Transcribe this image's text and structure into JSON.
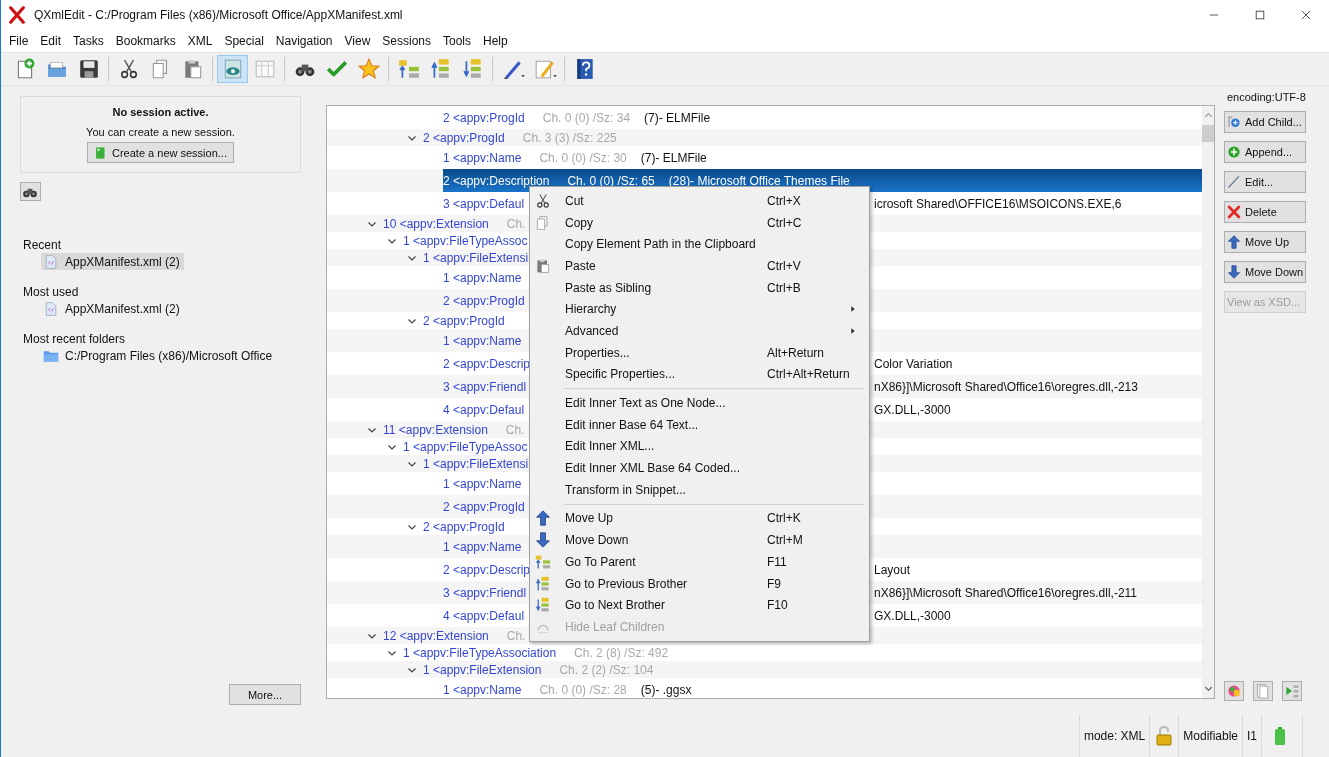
{
  "window": {
    "title": "QXmlEdit - C:/Program Files (x86)/Microsoft Office/AppXManifest.xml"
  },
  "menu_bar": [
    "File",
    "Edit",
    "Tasks",
    "Bookmarks",
    "XML",
    "Special",
    "Navigation",
    "View",
    "Sessions",
    "Tools",
    "Help"
  ],
  "toolbar": [
    {
      "selected": false
    },
    {
      "selected": false
    },
    {
      "selected": false
    },
    {
      "selected": false
    },
    {
      "selected": false
    },
    {
      "selected": false
    },
    {
      "selected": true
    },
    {
      "selected": false
    },
    {
      "selected": false
    },
    {
      "selected": false
    },
    {
      "selected": false
    },
    {
      "selected": false
    },
    {
      "selected": false
    },
    {
      "selected": false
    },
    {
      "selected": false
    },
    {
      "selected": false
    },
    {
      "selected": false
    }
  ],
  "session": {
    "title": "No session active.",
    "text": "You can create a new session.",
    "button": "Create a new session..."
  },
  "recent": [
    {
      "title": "Recent",
      "items": [
        {
          "label": "AppXManifest.xml (2)",
          "kind": "file",
          "selected": true
        }
      ]
    },
    {
      "title": "Most used",
      "items": [
        {
          "label": "AppXManifest.xml (2)",
          "kind": "file",
          "selected": false
        }
      ]
    },
    {
      "title": "Most recent folders",
      "items": [
        {
          "label": "C:/Program Files (x86)/Microsoft Office",
          "kind": "folder",
          "selected": false
        }
      ]
    }
  ],
  "more_button": "More...",
  "tree": {
    "rows": [
      {
        "children": [
          {
            "children": [
              {
                "children": [
                  {
                    "label": "2 <appv:ProgId",
                    "info": "Ch. 0 (0) /Sz: 34",
                    "value": "(7)- ELMFile",
                    "selected": false
                  }
                ]
              },
              {
                "label": "2 <appv:ProgId",
                "info": "Ch. 3 (3) /Sz: 225",
                "expanded": true,
                "selected": false,
                "children": [
                  {
                    "label": "1 <appv:Name",
                    "info": "Ch. 0 (0) /Sz: 30",
                    "value": "(7)- ELMFile",
                    "selected": false
                  },
                  {
                    "label": "2 <appv:Description",
                    "info": "Ch. 0 (0) /Sz: 65",
                    "value": "(28)- Microsoft Office Themes File",
                    "selected": true
                  },
                  {
                    "label": "3 <appv:Defaul",
                    "tail": "icrosoft Shared\\OFFICE16\\MSOICONS.EXE,6",
                    "selected": false
                  }
                ]
              }
            ]
          }
        ]
      },
      {
        "label": "10 <appv:Extension",
        "info": "Ch.",
        "expanded": true,
        "selected": false,
        "children": [
          {
            "label": "1 <appv:FileTypeAssoc",
            "expanded": true,
            "selected": false,
            "children": [
              {
                "label": "1 <appv:FileExtensi",
                "expanded": true,
                "selected": false,
                "children": [
                  {
                    "label": "1 <appv:Name",
                    "selected": false
                  },
                  {
                    "label": "2 <appv:ProgId",
                    "selected": false
                  }
                ]
              },
              {
                "label": "2 <appv:ProgId",
                "expanded": true,
                "selected": false,
                "children": [
                  {
                    "label": "1 <appv:Name",
                    "selected": false
                  },
                  {
                    "label": "2 <appv:Descrip",
                    "tail": "Color Variation",
                    "selected": false
                  },
                  {
                    "label": "3 <appv:Friendl",
                    "tail": "nX86}]\\Microsoft Shared\\Office16\\oregres.dll,-213",
                    "selected": false
                  },
                  {
                    "label": "4 <appv:Defaul",
                    "tail": "GX.DLL,-3000",
                    "selected": false
                  }
                ]
              }
            ]
          }
        ]
      },
      {
        "label": "11 <appv:Extension",
        "info": "Ch.",
        "expanded": true,
        "selected": false,
        "children": [
          {
            "label": "1 <appv:FileTypeAssoc",
            "expanded": true,
            "selected": false,
            "children": [
              {
                "label": "1 <appv:FileExtensi",
                "expanded": true,
                "selected": false,
                "children": [
                  {
                    "label": "1 <appv:Name",
                    "selected": false
                  },
                  {
                    "label": "2 <appv:ProgId",
                    "selected": false
                  }
                ]
              },
              {
                "label": "2 <appv:ProgId",
                "expanded": true,
                "selected": false,
                "children": [
                  {
                    "label": "1 <appv:Name",
                    "selected": false
                  },
                  {
                    "label": "2 <appv:Descrip",
                    "tail": "Layout",
                    "selected": false
                  },
                  {
                    "label": "3 <appv:Friendl",
                    "tail": "nX86}]\\Microsoft Shared\\Office16\\oregres.dll,-211",
                    "selected": false
                  },
                  {
                    "label": "4 <appv:Defaul",
                    "tail": "GX.DLL,-3000",
                    "selected": false
                  }
                ]
              }
            ]
          }
        ]
      },
      {
        "label": "12 <appv:Extension",
        "info": "Ch.",
        "expanded": true,
        "selected": false,
        "children": [
          {
            "label": "1 <appv:FileTypeAssociation",
            "info": "Ch. 2 (8) /Sz: 492",
            "expanded": true,
            "selected": false,
            "children": [
              {
                "label": "1 <appv:FileExtension",
                "info": "Ch. 2 (2) /Sz: 104",
                "expanded": true,
                "selected": false,
                "children": [
                  {
                    "label": "1 <appv:Name",
                    "info": "Ch. 0 (0) /Sz: 28",
                    "value": "(5)- .ggsx",
                    "selected": false
                  }
                ]
              }
            ]
          }
        ]
      }
    ]
  },
  "context_menu": {
    "items": [
      {
        "kind": "item",
        "label": "Cut",
        "shortcut": "Ctrl+X",
        "submenu": false,
        "disabled": false
      },
      {
        "kind": "item",
        "label": "Copy",
        "shortcut": "Ctrl+C",
        "submenu": false,
        "disabled": false
      },
      {
        "kind": "item",
        "label": "Copy Element Path in the Clipboard",
        "submenu": false,
        "disabled": false
      },
      {
        "kind": "item",
        "label": "Paste",
        "shortcut": "Ctrl+V",
        "submenu": false,
        "disabled": false
      },
      {
        "kind": "item",
        "label": "Paste as Sibling",
        "shortcut": "Ctrl+B",
        "submenu": false,
        "disabled": false
      },
      {
        "kind": "item",
        "label": "Hierarchy",
        "submenu": true,
        "disabled": false
      },
      {
        "kind": "item",
        "label": "Advanced",
        "submenu": true,
        "disabled": false
      },
      {
        "kind": "item",
        "label": "Properties...",
        "shortcut": "Alt+Return",
        "submenu": false,
        "disabled": false
      },
      {
        "kind": "item",
        "label": "Specific Properties...",
        "shortcut": "Ctrl+Alt+Return",
        "submenu": false,
        "disabled": false
      },
      {
        "kind": "separator"
      },
      {
        "kind": "item",
        "label": "Edit Inner Text as One Node...",
        "submenu": false,
        "disabled": false
      },
      {
        "kind": "item",
        "label": "Edit inner Base 64 Text...",
        "submenu": false,
        "disabled": false
      },
      {
        "kind": "item",
        "label": "Edit Inner XML...",
        "submenu": false,
        "disabled": false
      },
      {
        "kind": "item",
        "label": "Edit Inner XML Base 64 Coded...",
        "submenu": false,
        "disabled": false
      },
      {
        "kind": "item",
        "label": "Transform in Snippet...",
        "submenu": false,
        "disabled": false
      },
      {
        "kind": "separator"
      },
      {
        "kind": "item",
        "label": "Move Up",
        "shortcut": "Ctrl+K",
        "submenu": false,
        "disabled": false
      },
      {
        "kind": "item",
        "label": "Move Down",
        "shortcut": "Ctrl+M",
        "submenu": false,
        "disabled": false
      },
      {
        "kind": "item",
        "label": "Go To Parent",
        "shortcut": "F11",
        "submenu": false,
        "disabled": false
      },
      {
        "kind": "item",
        "label": "Go to Previous Brother",
        "shortcut": "F9",
        "submenu": false,
        "disabled": false
      },
      {
        "kind": "item",
        "label": "Go to Next Brother",
        "shortcut": "F10",
        "submenu": false,
        "disabled": false
      },
      {
        "kind": "item",
        "label": "Hide Leaf Children",
        "submenu": false,
        "disabled": true
      }
    ]
  },
  "side_panel": {
    "encoding": "encoding:UTF-8",
    "buttons": [
      {
        "label": "Add Child...",
        "disabled": false
      },
      {
        "label": "Append...",
        "disabled": false
      },
      {
        "label": "Edit...",
        "disabled": false
      },
      {
        "label": "Delete",
        "disabled": false
      },
      {
        "label": "Move Up",
        "disabled": false
      },
      {
        "label": "Move Down",
        "disabled": false
      },
      {
        "label": "View as XSD...",
        "disabled": true
      }
    ]
  },
  "status_bar": {
    "mode": "mode: XML",
    "edit_state": "Modifiable",
    "indicator": "I1"
  }
}
